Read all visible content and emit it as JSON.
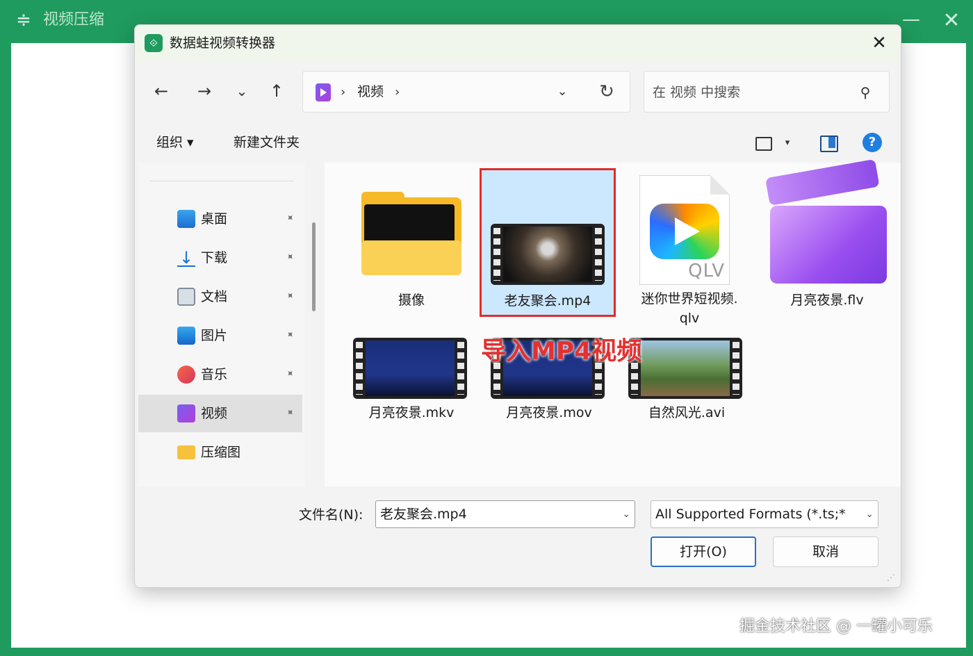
{
  "app": {
    "title": "视频压缩",
    "menu_icon": "≑",
    "minimize_icon": "—",
    "close_icon": "✕",
    "accent": "#1f9b5f"
  },
  "dialog": {
    "title": "数据蛙视频转换器",
    "close_icon": "✕",
    "nav": {
      "back": "←",
      "forward": "→",
      "recent": "⌄",
      "up": "↑"
    },
    "address": {
      "separator": "›",
      "crumb": "视频",
      "dropdown": "⌄",
      "refresh": "↻"
    },
    "search": {
      "placeholder": "在 视频 中搜索",
      "icon": "⚲"
    },
    "command_bar": {
      "organize": "组织 ▾",
      "new_folder": "新建文件夹",
      "view_dropdown": "▾"
    },
    "sidebar": {
      "pin_icon": "📌",
      "items": [
        {
          "label": "桌面",
          "icon": "desktop-icon",
          "pinned": true
        },
        {
          "label": "下载",
          "icon": "download-icon",
          "pinned": true
        },
        {
          "label": "文档",
          "icon": "documents-icon",
          "pinned": true
        },
        {
          "label": "图片",
          "icon": "pictures-icon",
          "pinned": true
        },
        {
          "label": "音乐",
          "icon": "music-icon",
          "pinned": true
        },
        {
          "label": "视频",
          "icon": "videos-icon",
          "pinned": true,
          "selected": true
        },
        {
          "label": "压缩图",
          "icon": "folder-icon",
          "pinned": false
        }
      ]
    },
    "files": [
      {
        "name": "摄像",
        "type": "folder"
      },
      {
        "name": "老友聚会.mp4",
        "type": "video",
        "selected": true
      },
      {
        "name": "迷你世界短视频.",
        "name_line2": "qlv",
        "type": "qlv",
        "badge": "QLV"
      },
      {
        "name": "月亮夜景.flv",
        "type": "flv"
      },
      {
        "name": "月亮夜景.mkv",
        "type": "video"
      },
      {
        "name": "月亮夜景.mov",
        "type": "video"
      },
      {
        "name": "自然风光.avi",
        "type": "video"
      }
    ],
    "annotation": "导入MP4视频",
    "footer": {
      "filename_label": "文件名(N):",
      "filename_value": "老友聚会.mp4",
      "dropdown": "⌄",
      "filter_value": "All Supported Formats (*.ts;*",
      "open_button": "打开(O)",
      "cancel_button": "取消",
      "grip": "⋰"
    }
  },
  "watermark": "掘金技术社区 @ 一罐小可乐"
}
